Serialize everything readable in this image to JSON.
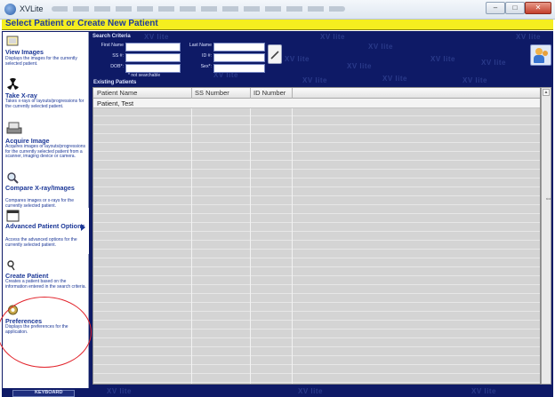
{
  "window": {
    "title": "XVLite",
    "controls": {
      "minimize": "–",
      "maximize": "□",
      "close": "✕"
    }
  },
  "header": {
    "title": "Select Patient or Create New Patient"
  },
  "sidebar": {
    "items": [
      {
        "id": "view-images",
        "icon": "images-icon",
        "title": "View Images",
        "description": "Displays the images for the currently selected patient."
      },
      {
        "id": "take-xray",
        "icon": "radiation-icon",
        "title": "Take X-ray",
        "description": "Takes x-rays or layouts/progressions for the currently selected patient."
      },
      {
        "id": "acquire-image",
        "icon": "scanner-icon",
        "title": "Acquire Image",
        "description": "Acquires images or layouts/progressions for the currently selected patient from a scanner, imaging device or camera."
      },
      {
        "id": "compare",
        "icon": "magnifier-icon",
        "title": "Compare X-ray/Images",
        "description": "Compares images or x-rays for the currently selected patient."
      },
      {
        "id": "advanced",
        "icon": "window-icon",
        "title": "Advanced Patient Options",
        "description": "Access the advanced options for the currently selected patient."
      },
      {
        "id": "create-patient",
        "icon": "key-icon",
        "title": "Create Patient",
        "description": "Creates a patient based on the information entered in the search criteria."
      },
      {
        "id": "preferences",
        "icon": "preferences-icon",
        "title": "Preferences",
        "description": "Displays the preferences for the application."
      }
    ],
    "keyboard_label": "KEYBOARD"
  },
  "search": {
    "heading": "Search Criteria",
    "first_name_label": "First Name",
    "last_name_label": "Last Name",
    "ss_label": "SS #:",
    "id_label": "ID #:",
    "dob_label": "DOB*:",
    "sex_label": "Sex*:",
    "first_name_value": "",
    "last_name_value": "",
    "ss_value": "",
    "id_value": "",
    "dob_value": "",
    "sex_value": "",
    "note": "* not searchable"
  },
  "watermark": "XV lite",
  "table": {
    "heading": "Existing Patients",
    "columns": [
      "Patient Name",
      "SS Number",
      "ID Number"
    ],
    "rows": [
      {
        "name": "Patient, Test",
        "ss": "",
        "id": ""
      }
    ]
  },
  "colors": {
    "header_yellow": "#f5ee1f",
    "title_blue": "#1d3a9c",
    "background_navy": "#0e1a66",
    "highlight_red": "#e2232b"
  }
}
